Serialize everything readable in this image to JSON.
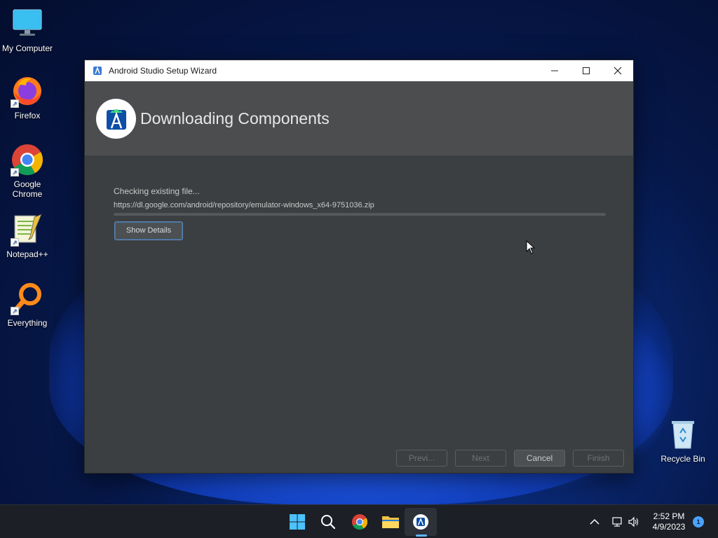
{
  "desktop": {
    "icons": [
      {
        "label": "My Computer",
        "icon": "monitor-icon"
      },
      {
        "label": "Firefox",
        "icon": "firefox-icon"
      },
      {
        "label": "Google Chrome",
        "icon": "chrome-icon"
      },
      {
        "label": "Notepad++",
        "icon": "notepadpp-icon"
      },
      {
        "label": "Everything",
        "icon": "everything-search-icon"
      },
      {
        "label": "Recycle Bin",
        "icon": "recycle-bin-icon"
      }
    ]
  },
  "window": {
    "title": "Android Studio Setup Wizard",
    "header_title": "Downloading Components",
    "status": "Checking existing file...",
    "url": "https://dl.google.com/android/repository/emulator-windows_x64-9751036.zip",
    "progress": 0,
    "show_details_label": "Show Details",
    "buttons": {
      "prev": "Previ...",
      "next": "Next",
      "cancel": "Cancel",
      "finish": "Finish"
    }
  },
  "taskbar": {
    "apps": [
      "start-icon",
      "search-icon",
      "chrome-icon",
      "file-explorer-icon",
      "android-studio-icon"
    ],
    "time": "2:52 PM",
    "date": "4/9/2023",
    "notification_count": "1"
  },
  "colors": {
    "window_bg": "#3c3f41",
    "header_bg": "#4b4d4f",
    "taskbar_bg": "#1c1f26",
    "accent": "#5a87b8"
  }
}
